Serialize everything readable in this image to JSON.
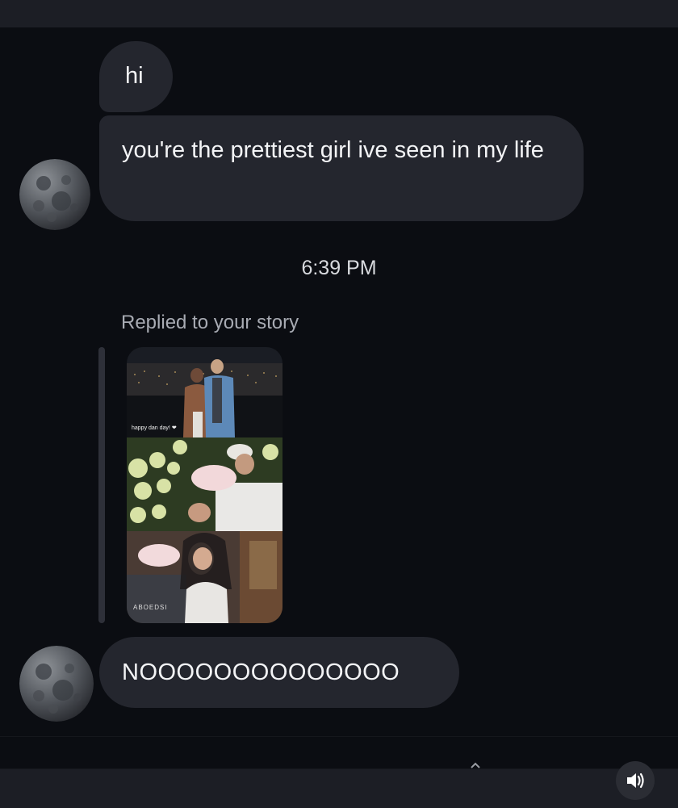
{
  "messages": {
    "hi": "hi",
    "pretty": "you're the prettiest girl ive seen in my life",
    "no": "NOOOOOOOOOOOOOO"
  },
  "timestamp": "6:39 PM",
  "story_reply": {
    "label": "Replied to your story",
    "caption": "happy dan day! ❤",
    "shirt_text": "ABOEDSI"
  },
  "icons": {
    "avatar": "moon-avatar-icon",
    "sound": "speaker-icon",
    "chevron": "chevron-up-icon"
  },
  "colors": {
    "background": "#0b0d12",
    "bubble": "#24262e",
    "text": "#f3f4f6",
    "muted": "#a8abb3"
  }
}
